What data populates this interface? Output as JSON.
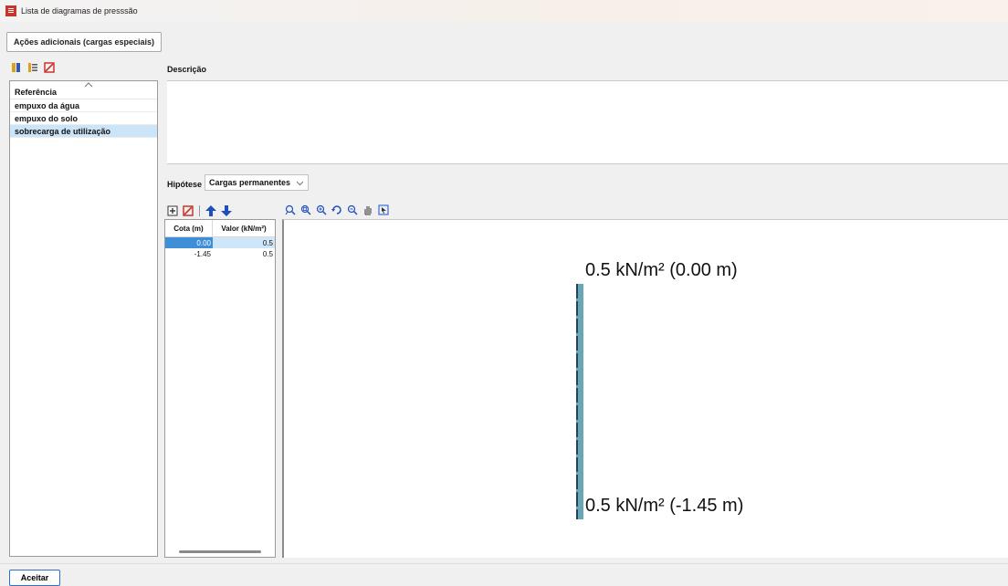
{
  "window": {
    "title": "Lista de diagramas de presssão"
  },
  "toolbar": {
    "additional_actions_label": "Ações adicionais (cargas especiais)"
  },
  "references": {
    "header": "Referência",
    "items": [
      {
        "label": "empuxo da água"
      },
      {
        "label": "empuxo do solo"
      },
      {
        "label": "sobrecarga de utilização"
      }
    ],
    "selected_index": 2
  },
  "description": {
    "label": "Descrição",
    "value": ""
  },
  "hypothesis": {
    "label": "Hipótese",
    "selected": "Cargas permanentes"
  },
  "table": {
    "columns": [
      "Cota (m)",
      "Valor (kN/m²)"
    ],
    "rows": [
      {
        "cota": "0.00",
        "valor": "0.5"
      },
      {
        "cota": "-1.45",
        "valor": "0.5"
      }
    ]
  },
  "diagram": {
    "top_label": "0.5 kN/m² (0.00 m)",
    "bottom_label": "0.5 kN/m² (-1.45 m)",
    "bar_color": "#6aa7b5",
    "axis_color": "#2b3f63"
  },
  "footer": {
    "accept_label": "Aceitar"
  },
  "colors": {
    "selection": "#cce4f7",
    "selection_strong": "#3f8fd8",
    "accent_red": "#c8362b",
    "accent_blue": "#1f4fbf"
  }
}
